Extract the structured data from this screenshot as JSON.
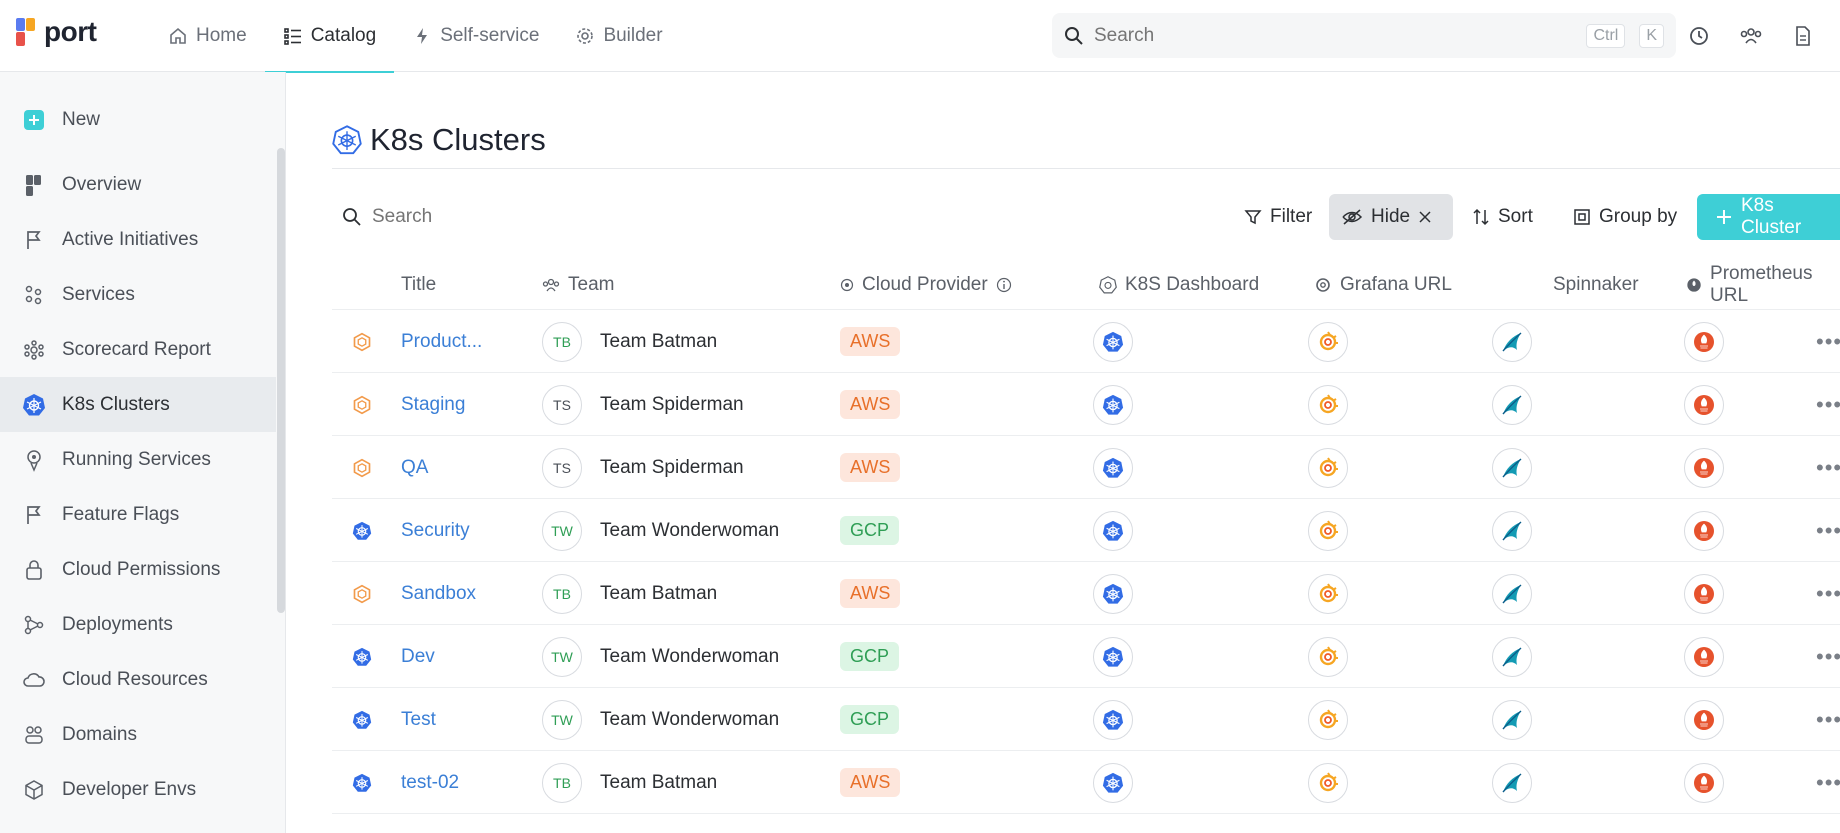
{
  "app": {
    "logo_text": "port"
  },
  "nav": [
    {
      "label": "Home",
      "icon": "home-icon"
    },
    {
      "label": "Catalog",
      "icon": "catalog-icon",
      "active": true
    },
    {
      "label": "Self-service",
      "icon": "lightning-icon"
    },
    {
      "label": "Builder",
      "icon": "gear-icon"
    }
  ],
  "search": {
    "placeholder": "Search",
    "shortcut_ctrl": "Ctrl",
    "shortcut_key": "K"
  },
  "sidebar": {
    "new_label": "New",
    "items": [
      {
        "label": "Overview",
        "icon": "port-logo-icon"
      },
      {
        "label": "Active Initiatives",
        "icon": "flag-icon"
      },
      {
        "label": "Services",
        "icon": "services-icon"
      },
      {
        "label": "Scorecard Report",
        "icon": "gear-cluster-icon"
      },
      {
        "label": "K8s Clusters",
        "icon": "kubernetes-icon",
        "active": true
      },
      {
        "label": "Running Services",
        "icon": "running-services-icon"
      },
      {
        "label": "Feature Flags",
        "icon": "flag-icon"
      },
      {
        "label": "Cloud Permissions",
        "icon": "lock-icon"
      },
      {
        "label": "Deployments",
        "icon": "deployments-icon"
      },
      {
        "label": "Cloud Resources",
        "icon": "cloud-icon"
      },
      {
        "label": "Domains",
        "icon": "domains-icon"
      },
      {
        "label": "Developer Envs",
        "icon": "cube-icon"
      }
    ]
  },
  "page": {
    "title": "K8s Clusters"
  },
  "toolbar": {
    "search_placeholder": "Search",
    "filter_label": "Filter",
    "hide_label": "Hide",
    "sort_label": "Sort",
    "group_label": "Group by",
    "create_label": "K8s Cluster"
  },
  "table": {
    "columns": [
      "Title",
      "Team",
      "Cloud Provider",
      "K8S Dashboard",
      "Grafana URL",
      "Spinnaker",
      "Prometheus URL"
    ],
    "rows": [
      {
        "icon": "aws-cluster-icon",
        "title": "Product...",
        "team_initials": "TB",
        "team": "Team Batman",
        "provider": "AWS"
      },
      {
        "icon": "aws-cluster-icon",
        "title": "Staging",
        "team_initials": "TS",
        "team": "Team Spiderman",
        "provider": "AWS"
      },
      {
        "icon": "aws-cluster-icon",
        "title": "QA",
        "team_initials": "TS",
        "team": "Team Spiderman",
        "provider": "AWS"
      },
      {
        "icon": "kubernetes-icon",
        "title": "Security",
        "team_initials": "TW",
        "team": "Team Wonderwoman",
        "provider": "GCP"
      },
      {
        "icon": "aws-cluster-icon",
        "title": "Sandbox",
        "team_initials": "TB",
        "team": "Team Batman",
        "provider": "AWS"
      },
      {
        "icon": "kubernetes-icon",
        "title": "Dev",
        "team_initials": "TW",
        "team": "Team Wonderwoman",
        "provider": "GCP"
      },
      {
        "icon": "kubernetes-icon",
        "title": "Test",
        "team_initials": "TW",
        "team": "Team Wonderwoman",
        "provider": "GCP"
      },
      {
        "icon": "kubernetes-icon",
        "title": "test-02",
        "team_initials": "TB",
        "team": "Team Batman",
        "provider": "AWS"
      }
    ]
  },
  "colors": {
    "accent": "#3ecfd6",
    "link": "#3b7fd6",
    "aws_bg": "#fde6dc",
    "aws_fg": "#e8702a",
    "gcp_bg": "#dcf5e4",
    "gcp_fg": "#2f9e55",
    "initials_tb": "#2f9e55",
    "initials_ts": "#4a4f57",
    "initials_tw": "#2f9e55"
  }
}
